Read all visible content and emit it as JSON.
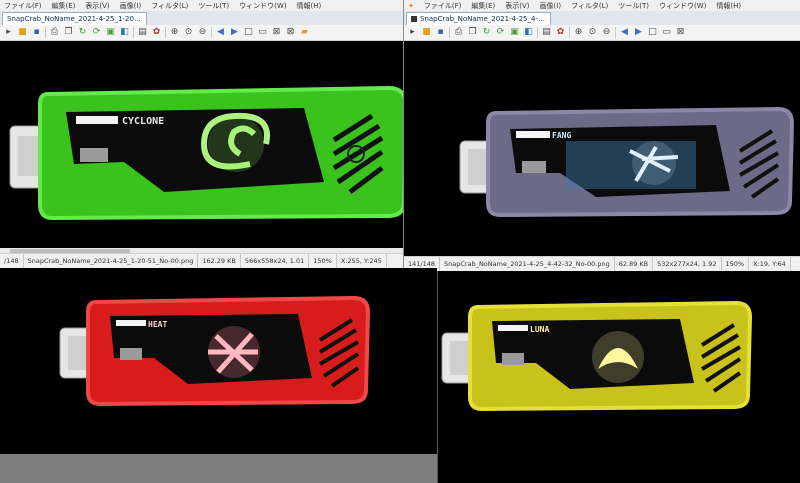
{
  "left_window": {
    "menu": [
      "ファイル(F)",
      "編集(E)",
      "表示(V)",
      "画像(I)",
      "フィルタ(L)",
      "ツール(T)",
      "ウィンドウ(W)",
      "情報(H)"
    ],
    "tab_title": "SnapCrab_NoName_2021-4-25_1-20-5...",
    "status": {
      "index": "/148",
      "filename": "SnapCrab_NoName_2021-4-25_1-20-51_No-00.png",
      "filesize": "162.29 KB",
      "dimensions": "566x558x24, 1.01",
      "zoom": "150%",
      "coords": "X:255, Y:245"
    }
  },
  "right_window": {
    "menu": [
      "ファイル(F)",
      "編集(E)",
      "表示(V)",
      "画像(I)",
      "フィルタ(L)",
      "ツール(T)",
      "ウィンドウ(W)",
      "情報(H)"
    ],
    "tab_title": "SnapCrab_NoName_2021-4-25_4-42-3...",
    "status": {
      "index": "141/148",
      "filename": "SnapCrab_NoName_2021-4-25_4-42-32_No-00.png",
      "filesize": "62.89 KB",
      "dimensions": "532x277x24, 1.92",
      "zoom": "150%",
      "coords": "X:19, Y:64"
    }
  },
  "toolbar_icons": [
    "open-icon",
    "folder-icon",
    "save-icon",
    "print-icon",
    "copy-icon",
    "rotate-icon",
    "refresh-icon",
    "filter-icon",
    "adjust-icon",
    "slideshow-icon",
    "info-icon",
    "zoom-in-icon",
    "zoom-fit-icon",
    "zoom-out-icon",
    "prev-icon",
    "next-icon",
    "fullscreen-icon",
    "window-icon",
    "close-icon"
  ],
  "devices": {
    "cyclone": {
      "label": "CYCLONE",
      "body_color": "#33c41c",
      "rim_color": "#5be84a",
      "glow_color": "#b8ff8a"
    },
    "fang": {
      "label": "FANG",
      "body_color": "#6c6a86",
      "rim_color": "#8a88a6",
      "glow_color": "#cfe8ff"
    },
    "heat": {
      "label": "HEAT",
      "body_color": "#d81c1c",
      "rim_color": "#f04848",
      "glow_color": "#ffb8c0"
    },
    "luna": {
      "label": "LUNA",
      "body_color": "#c9c21a",
      "rim_color": "#e6df3a",
      "glow_color": "#fff6a0"
    }
  }
}
